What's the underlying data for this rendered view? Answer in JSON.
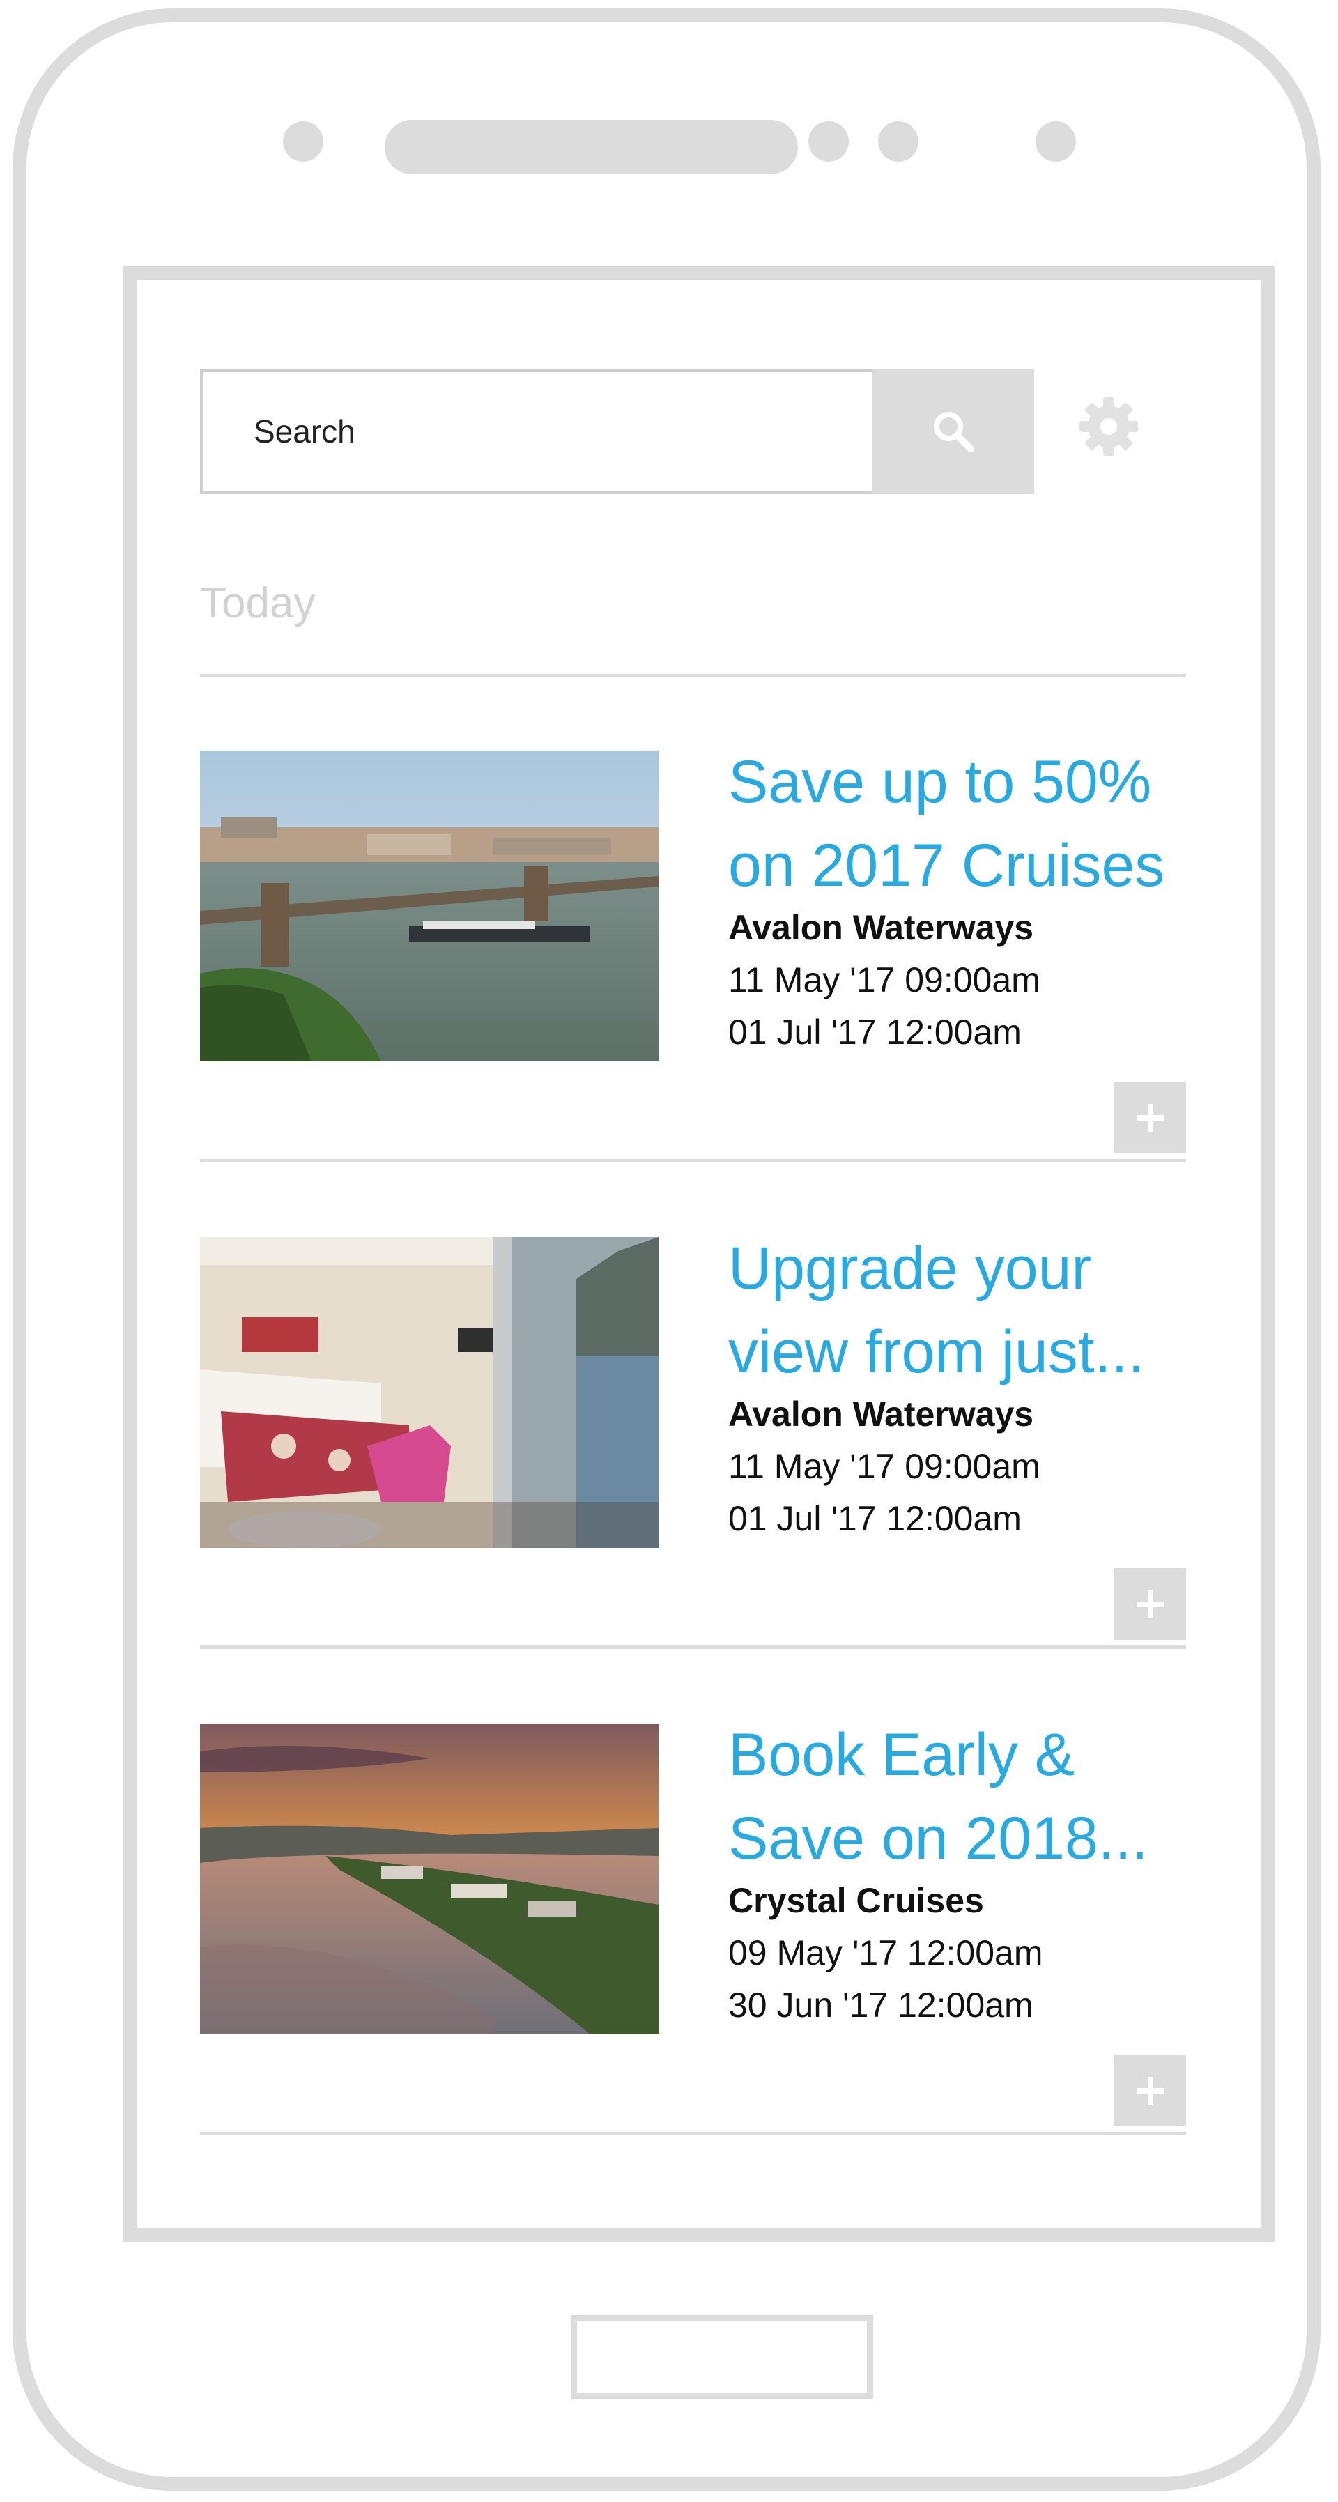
{
  "search": {
    "placeholder": "Search"
  },
  "section": {
    "title": "Today"
  },
  "deals": [
    {
      "title": "Save up to 50% on 2017 Cruises",
      "vendor": "Avalon Waterways",
      "start": "11 May '17 09:00am",
      "end": "01 Jul '17 12:00am"
    },
    {
      "title": "Upgrade your view from just...",
      "vendor": "Avalon Waterways",
      "start": "11 May '17 09:00am",
      "end": "01 Jul '17 12:00am"
    },
    {
      "title": "Book Early & Save on 2018...",
      "vendor": "Crystal Cruises",
      "start": "09 May '17 12:00am",
      "end": "30 Jun '17 12:00am"
    }
  ],
  "icons": {
    "search": "search-icon",
    "settings": "gear-icon",
    "add": "plus-icon"
  },
  "colors": {
    "accent": "#27a9e1",
    "frame": "#dcdcdc",
    "text": "#111111",
    "muted": "#d2d2d2"
  }
}
